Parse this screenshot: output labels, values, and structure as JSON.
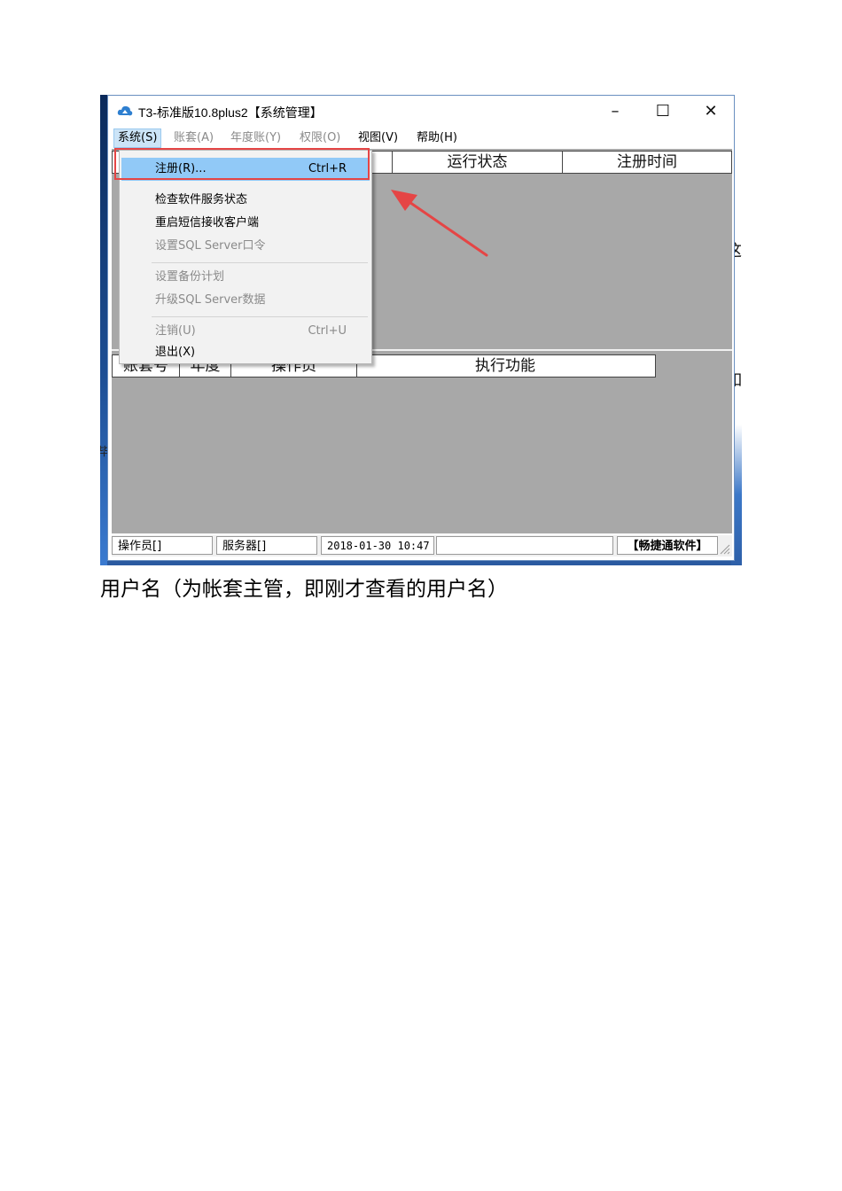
{
  "window": {
    "title": "T3-标准版10.8plus2【系统管理】",
    "minimize": "–",
    "maximize": "☐",
    "close": "✕"
  },
  "menubar": {
    "items": [
      {
        "label": "系统(S)",
        "state": "active"
      },
      {
        "label": "账套(A)",
        "state": "disabled"
      },
      {
        "label": "年度账(Y)",
        "state": "disabled"
      },
      {
        "label": "权限(O)",
        "state": "disabled"
      },
      {
        "label": "视图(V)",
        "state": "enabled"
      },
      {
        "label": "帮助(H)",
        "state": "enabled"
      }
    ]
  },
  "dropdown": {
    "items": [
      {
        "label": "注册(R)...",
        "shortcut": "Ctrl+R",
        "state": "highlighted"
      },
      {
        "label": "检查软件服务状态",
        "shortcut": "",
        "state": "enabled"
      },
      {
        "label": "重启短信接收客户端",
        "shortcut": "",
        "state": "enabled"
      },
      {
        "label": "设置SQL Server口令",
        "shortcut": "",
        "state": "disabled"
      },
      {
        "label": "设置备份计划",
        "shortcut": "",
        "state": "disabled"
      },
      {
        "label": "升级SQL Server数据",
        "shortcut": "",
        "state": "disabled"
      },
      {
        "label": "注销(U)",
        "shortcut": "Ctrl+U",
        "state": "disabled"
      },
      {
        "label": "退出(X)",
        "shortcut": "",
        "state": "enabled"
      }
    ]
  },
  "upper_table": {
    "headers": [
      "运行状态",
      "注册时间"
    ]
  },
  "lower_table": {
    "headers": [
      "账套号",
      "年度",
      "操作员",
      "执行功能"
    ]
  },
  "statusbar": {
    "operator": "操作员[]",
    "server": "服务器[]",
    "datetime": "2018-01-30 10:47",
    "empty": "",
    "brand": "【畅捷通软件】"
  },
  "desktop": {
    "left_hint": "毕",
    "right_hint_1": "这",
    "right_hint_2": "如"
  },
  "colors": {
    "menu_highlight": "#91c9f7",
    "annotation_red": "#e54545",
    "client_gray": "#a8a8a8"
  },
  "caption": "用户名（为帐套主管，即刚才查看的用户名）"
}
